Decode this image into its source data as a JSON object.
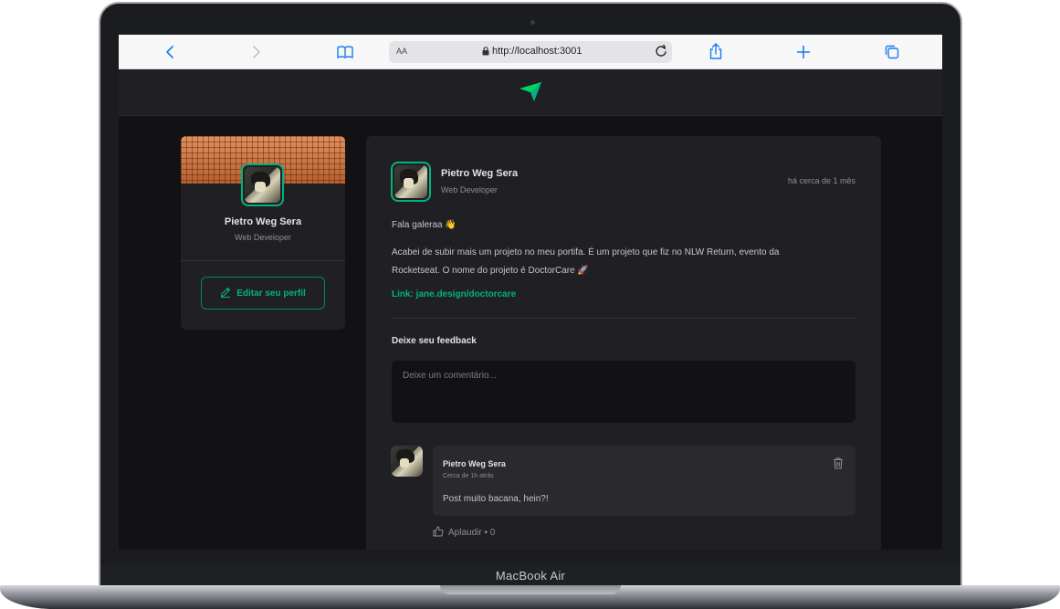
{
  "device": {
    "label": "MacBook Air"
  },
  "browser": {
    "text_size_label": "AA",
    "url": "http://localhost:3001"
  },
  "profile": {
    "name": "Pietro Weg Sera",
    "role": "Web Developer",
    "edit_button_label": "Editar seu perfil"
  },
  "post": {
    "author": "Pietro Weg Sera",
    "role": "Web Developer",
    "time": "há cerca de 1 mês",
    "greeting": "Fala galeraa 👋",
    "paragraph_line_1": "Acabei de subir mais um projeto no meu portifa. É um projeto que fiz no NLW Return, evento da",
    "paragraph_line_2": "Rocketseat. O nome do projeto é DoctorCare 🚀",
    "link": "Link: jane.design/doctorcare"
  },
  "feedback": {
    "title": "Deixe seu feedback",
    "placeholder": "Deixe um comentário..."
  },
  "comment": {
    "author": "Pietro Weg Sera",
    "time": "Cerca de 1h atrás",
    "text": "Post muito bacana, hein?!",
    "applaud_label": "Aplaudir • 0"
  },
  "colors": {
    "accent": "#00b37e",
    "background": "#121214",
    "surface": "#202024",
    "comment_surface": "#29292e"
  },
  "icons": [
    "back-icon",
    "forward-icon",
    "bookmarks-icon",
    "lock-icon",
    "reload-icon",
    "share-icon",
    "new-tab-icon",
    "tabs-icon",
    "logo-icon",
    "pencil-icon",
    "trash-icon",
    "thumbs-up-icon"
  ]
}
